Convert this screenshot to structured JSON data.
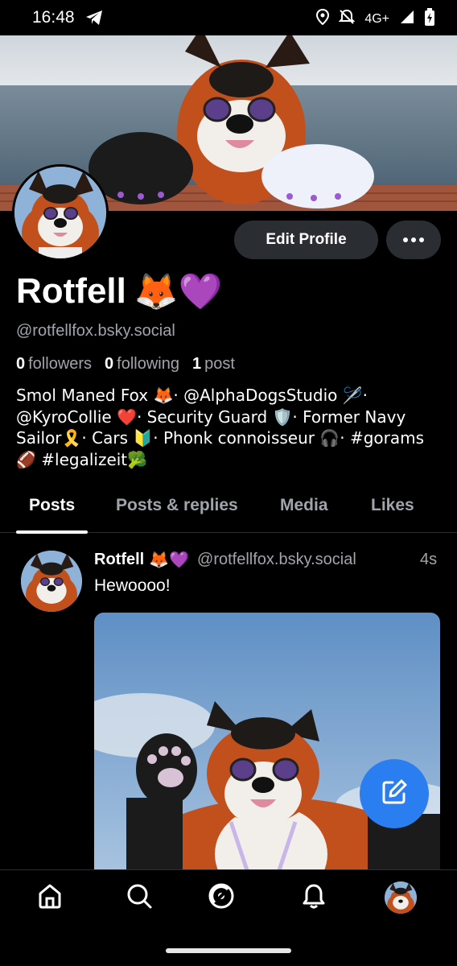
{
  "status_bar": {
    "time": "16:48",
    "network": "4G+",
    "icons": [
      "telegram-icon",
      "location-icon",
      "bell-off-icon",
      "signal-icon",
      "battery-icon"
    ]
  },
  "profile": {
    "display_name": "Rotfell",
    "name_emojis": "🦊💜",
    "handle": "@rotfellfox.bsky.social",
    "followers_count": "0",
    "followers_label": "followers",
    "following_count": "0",
    "following_label": "following",
    "posts_count": "1",
    "posts_label": "post",
    "bio": "Smol Maned Fox 🦊· @AlphaDogsStudio 🪡· @KyroCollie ❤️· Security Guard 🛡️· Former Navy Sailor🎗️· Cars 🔰·  Phonk connoisseur 🎧· #gorams 🏈 #legalizeit🥦"
  },
  "actions": {
    "edit_profile": "Edit Profile",
    "more_icon": "ellipsis-icon"
  },
  "tabs": [
    {
      "label": "Posts",
      "active": true
    },
    {
      "label": "Posts & replies",
      "active": false
    },
    {
      "label": "Media",
      "active": false
    },
    {
      "label": "Likes",
      "active": false
    }
  ],
  "post": {
    "author_name": "Rotfell",
    "author_emojis": "🦊💜",
    "author_handle": "@rotfellfox.bsky.social",
    "time": "4s",
    "text": "Hewoooo!"
  },
  "bottom_nav": [
    {
      "icon": "home-icon"
    },
    {
      "icon": "search-icon"
    },
    {
      "icon": "feeds-icon"
    },
    {
      "icon": "notifications-icon"
    },
    {
      "icon": "profile-avatar"
    }
  ],
  "colors": {
    "background": "#000000",
    "button_bg": "#2a2d32",
    "muted_text": "#a0a4ab",
    "accent": "#2b7ef0"
  }
}
